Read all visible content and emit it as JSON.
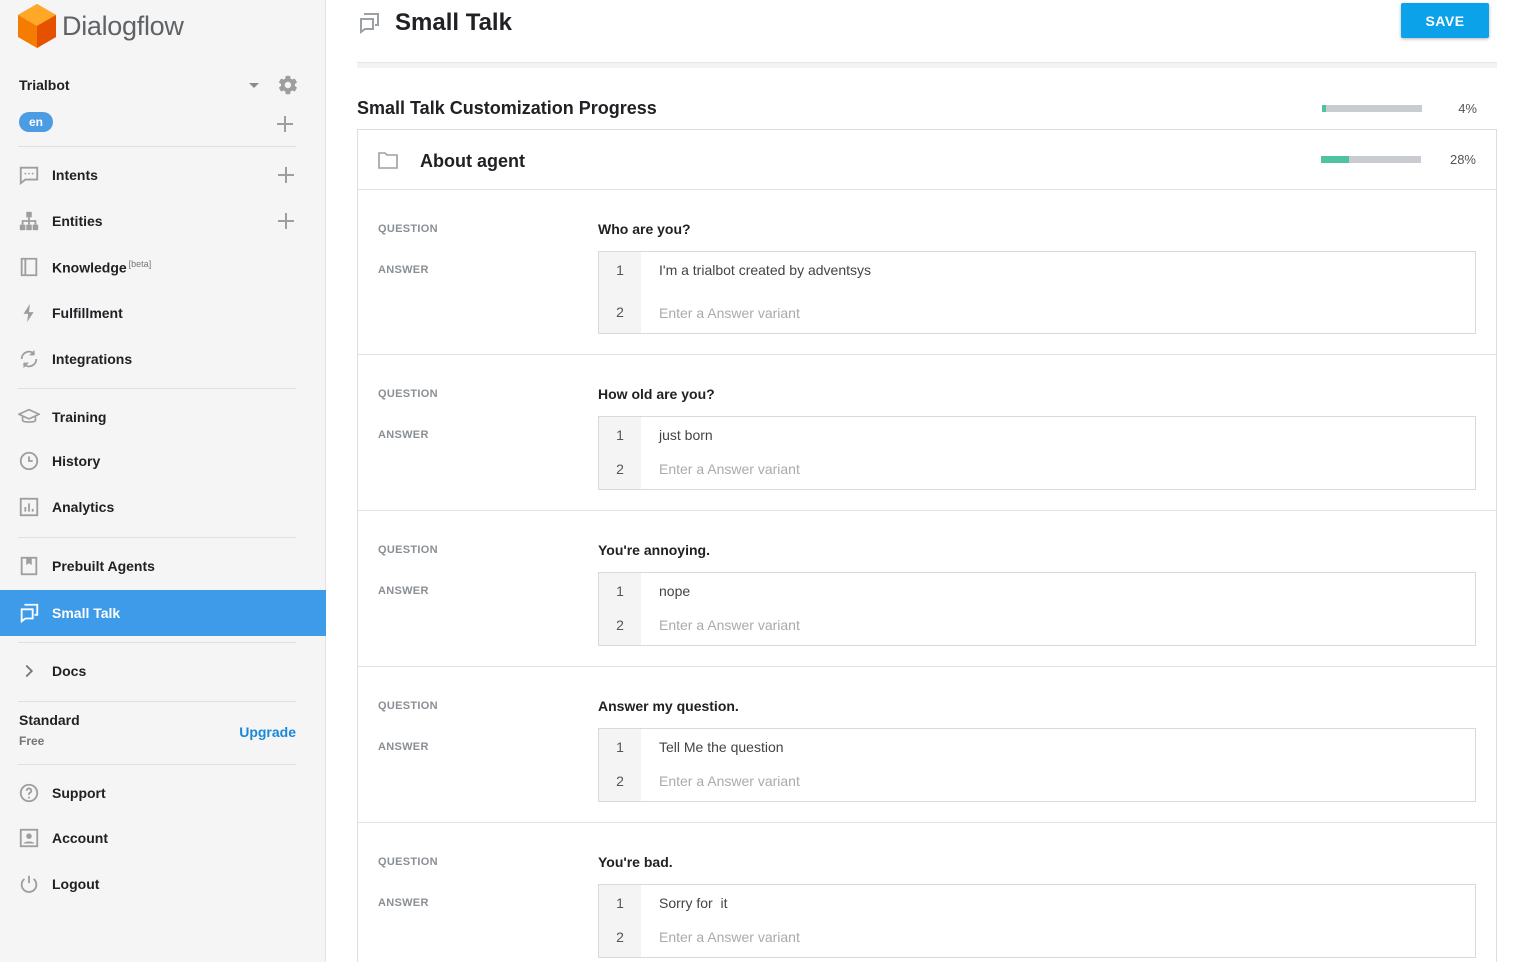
{
  "brand": {
    "name": "Dialogflow",
    "accent": "#f57c00"
  },
  "agent": {
    "name": "Trialbot",
    "language": "en"
  },
  "nav": {
    "intents": "Intents",
    "entities": "Entities",
    "knowledge": "Knowledge",
    "knowledge_badge": "[beta]",
    "fulfillment": "Fulfillment",
    "integrations": "Integrations",
    "training": "Training",
    "history": "History",
    "analytics": "Analytics",
    "prebuilt": "Prebuilt Agents",
    "smalltalk": "Small Talk",
    "docs": "Docs",
    "support": "Support",
    "account": "Account",
    "logout": "Logout"
  },
  "plan": {
    "name": "Standard",
    "tier": "Free",
    "upgrade_label": "Upgrade"
  },
  "page": {
    "title": "Small Talk",
    "save_label": "SAVE"
  },
  "progress": {
    "title": "Small Talk Customization Progress",
    "value": 0.04,
    "label": "4%"
  },
  "section": {
    "title": "About agent",
    "progress": 0.28,
    "progress_label": "28%"
  },
  "labels": {
    "question": "QUESTION",
    "answer": "ANSWER",
    "placeholder": "Enter a Answer variant"
  },
  "qa": [
    {
      "question": "Who are you?",
      "answer": "I'm a trialbot created by adventsys"
    },
    {
      "question": "How old are you?",
      "answer": "just born"
    },
    {
      "question": "You're annoying.",
      "answer": "nope"
    },
    {
      "question": "Answer my question.",
      "answer": "Tell Me the question"
    },
    {
      "question": "You're bad.",
      "answer": "Sorry for  it"
    }
  ],
  "colors": {
    "active_nav": "#3d9be9",
    "save_button": "#0ba2ea",
    "progress_fill": "#4fc3a1",
    "link": "#1a88d6"
  }
}
